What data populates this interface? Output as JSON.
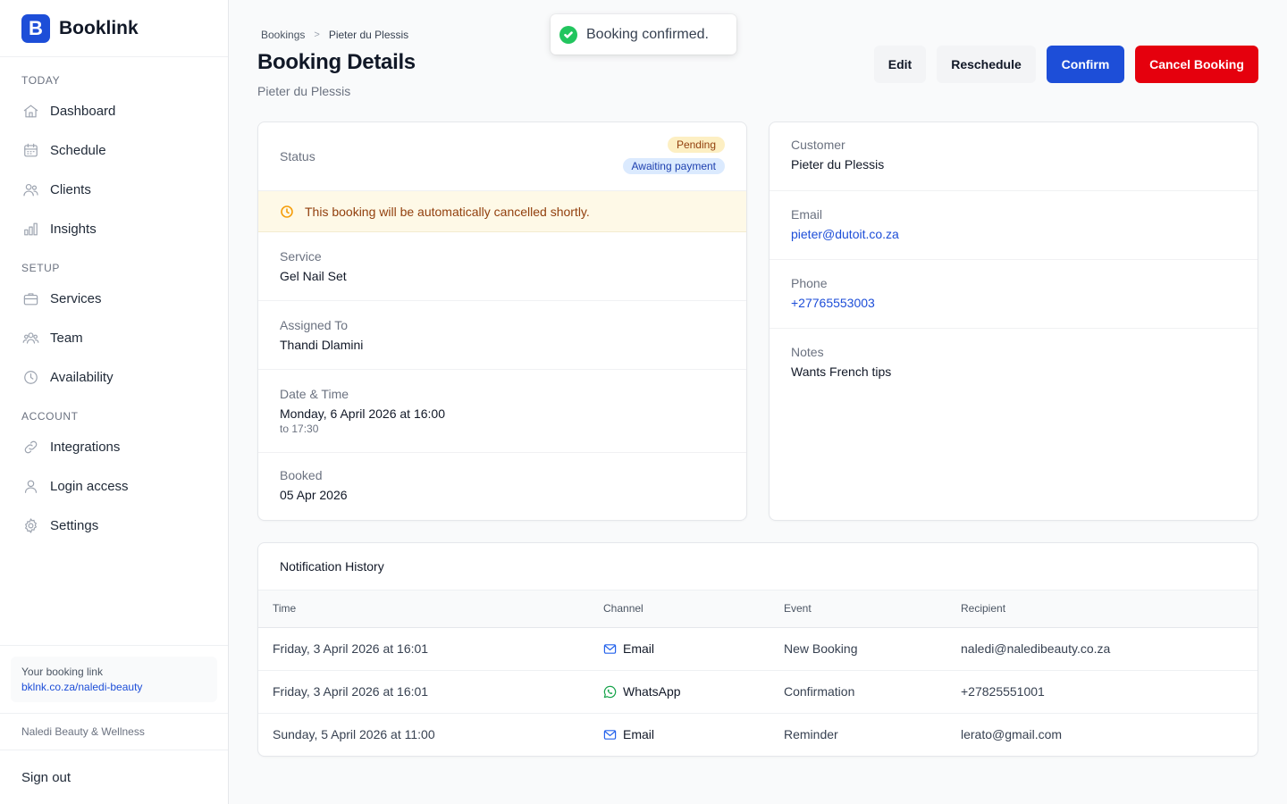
{
  "app": {
    "name": "Booklink",
    "logo_letter": "B",
    "accent": "#1d4ed8"
  },
  "sidebar": {
    "sections": [
      {
        "title": "TODAY",
        "items": [
          {
            "label": "Dashboard",
            "icon": "home-icon"
          },
          {
            "label": "Schedule",
            "icon": "calendar-icon"
          },
          {
            "label": "Clients",
            "icon": "users-icon"
          },
          {
            "label": "Insights",
            "icon": "bar-chart-icon"
          }
        ]
      },
      {
        "title": "SETUP",
        "items": [
          {
            "label": "Services",
            "icon": "briefcase-icon"
          },
          {
            "label": "Team",
            "icon": "team-icon"
          },
          {
            "label": "Availability",
            "icon": "clock-icon"
          }
        ]
      },
      {
        "title": "ACCOUNT",
        "items": [
          {
            "label": "Integrations",
            "icon": "link-icon"
          },
          {
            "label": "Login access",
            "icon": "user-icon"
          },
          {
            "label": "Settings",
            "icon": "gear-icon"
          }
        ]
      }
    ],
    "booking_link_label": "Your booking link",
    "booking_link_url": "bklnk.co.za/naledi-beauty",
    "business_name": "Naledi Beauty & Wellness",
    "sign_out": "Sign out"
  },
  "breadcrumb": {
    "parent": "Bookings",
    "separator": ">",
    "current": "Pieter du Plessis"
  },
  "page": {
    "title": "Booking Details",
    "subtitle": "Pieter du Plessis"
  },
  "actions": {
    "edit": "Edit",
    "reschedule": "Reschedule",
    "confirm": "Confirm",
    "cancel": "Cancel Booking"
  },
  "toast": {
    "message": "Booking confirmed.",
    "icon": "check-circle-icon"
  },
  "booking": {
    "status_label": "Status",
    "badges": {
      "pending": "Pending",
      "awaiting": "Awaiting payment"
    },
    "warning": "This booking will be automatically cancelled shortly.",
    "service_label": "Service",
    "service": "Gel Nail Set",
    "assigned_label": "Assigned To",
    "assigned": "Thandi Dlamini",
    "datetime_label": "Date & Time",
    "datetime": "Monday, 6 April 2026 at 16:00",
    "datetime_end": "to 17:30",
    "booked_label": "Booked",
    "booked": "05 Apr 2026"
  },
  "customer": {
    "customer_label": "Customer",
    "name": "Pieter du Plessis",
    "email_label": "Email",
    "email": "pieter@dutoit.co.za",
    "phone_label": "Phone",
    "phone": "+27765553003",
    "notes_label": "Notes",
    "notes": "Wants French tips"
  },
  "notifications": {
    "title": "Notification History",
    "columns": [
      "Time",
      "Channel",
      "Event",
      "Recipient"
    ],
    "rows": [
      {
        "time": "Friday, 3 April 2026 at 16:01",
        "channel": "Email",
        "channel_icon": "mail-icon",
        "event": "New Booking",
        "recipient": "naledi@naledibeauty.co.za"
      },
      {
        "time": "Friday, 3 April 2026 at 16:01",
        "channel": "WhatsApp",
        "channel_icon": "whatsapp-icon",
        "event": "Confirmation",
        "recipient": "+27825551001"
      },
      {
        "time": "Sunday, 5 April 2026 at 11:00",
        "channel": "Email",
        "channel_icon": "mail-icon",
        "event": "Reminder",
        "recipient": "lerato@gmail.com"
      }
    ]
  }
}
